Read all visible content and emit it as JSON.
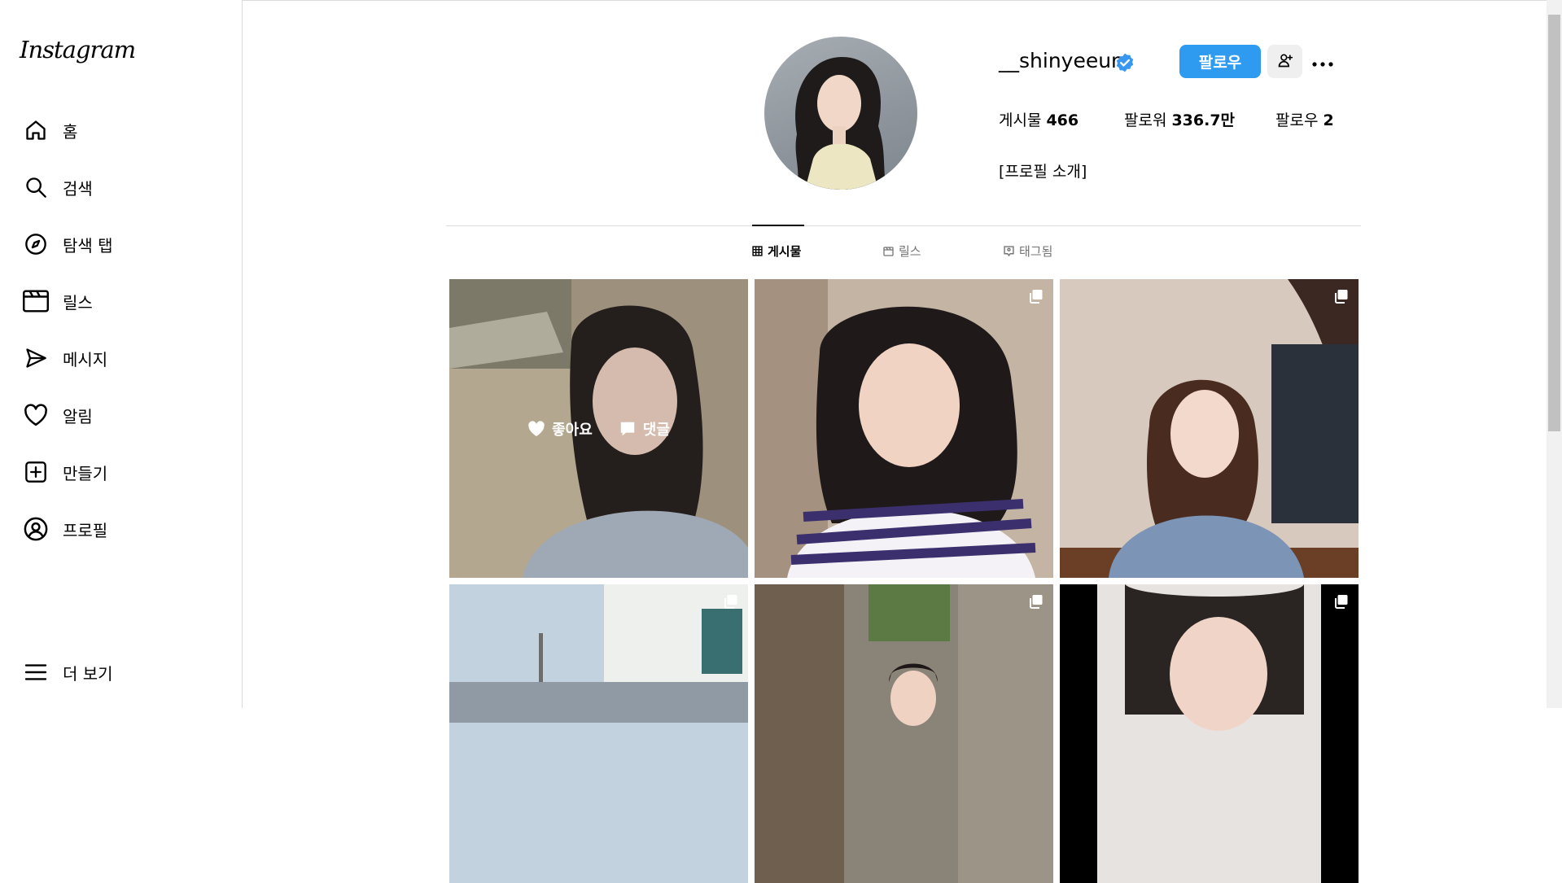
{
  "logo": "Instagram",
  "nav": [
    {
      "label": "홈",
      "icon": "home-icon"
    },
    {
      "label": "검색",
      "icon": "search-icon"
    },
    {
      "label": "탐색 탭",
      "icon": "compass-icon"
    },
    {
      "label": "릴스",
      "icon": "reels-icon"
    },
    {
      "label": "메시지",
      "icon": "send-icon"
    },
    {
      "label": "알림",
      "icon": "heart-icon"
    },
    {
      "label": "만들기",
      "icon": "create-icon"
    },
    {
      "label": "프로필",
      "icon": "profile-icon"
    }
  ],
  "more": {
    "label": "더 보기",
    "icon": "menu-icon"
  },
  "profile": {
    "username": "__shinyeeun",
    "verified": true,
    "follow_button": "팔로우",
    "stats": {
      "posts_label": "게시물",
      "posts_value": "466",
      "followers_label": "팔로워",
      "followers_value": "336.7만",
      "following_label": "팔로우",
      "following_value": "2"
    },
    "bio": "[프로필 소개]"
  },
  "tabs": [
    {
      "label": "게시물",
      "icon": "grid-icon",
      "active": true
    },
    {
      "label": "릴스",
      "icon": "reels-icon",
      "active": false
    },
    {
      "label": "태그됨",
      "icon": "tag-icon",
      "active": false
    }
  ],
  "hover_overlay": {
    "likes_label": "좋아요",
    "comments_label": "댓글"
  },
  "colors": {
    "accent": "#2f9bf0",
    "verified": "#3897f0",
    "border": "#dbdbdb"
  }
}
